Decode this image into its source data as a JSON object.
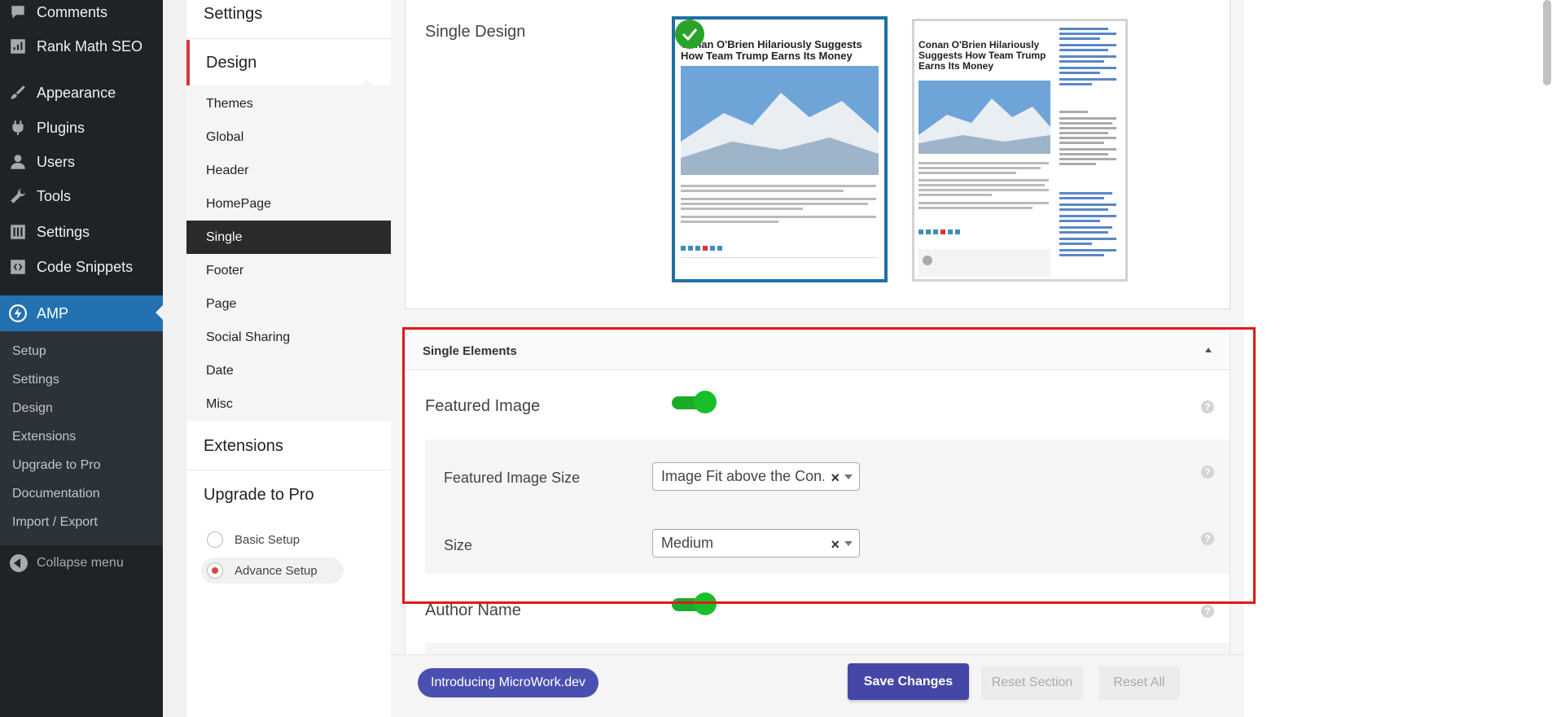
{
  "wp_menu": {
    "items": [
      {
        "label": "Comments",
        "icon": "comment-icon"
      },
      {
        "label": "Rank Math SEO",
        "icon": "rank-math-icon"
      },
      {
        "label": "Appearance",
        "icon": "paintbrush-icon"
      },
      {
        "label": "Plugins",
        "icon": "plug-icon"
      },
      {
        "label": "Users",
        "icon": "user-icon"
      },
      {
        "label": "Tools",
        "icon": "wrench-icon"
      },
      {
        "label": "Settings",
        "icon": "sliders-icon"
      },
      {
        "label": "Code Snippets",
        "icon": "code-icon"
      },
      {
        "label": "AMP",
        "icon": "amp-lightning-icon"
      }
    ],
    "amp_submenu": [
      "Setup",
      "Settings",
      "Design",
      "Extensions",
      "Upgrade to Pro",
      "Documentation",
      "Import / Export"
    ],
    "collapse_label": "Collapse menu"
  },
  "settings_nav": {
    "settings_heading": "Settings",
    "design_heading": "Design",
    "design_items": [
      "Themes",
      "Global",
      "Header",
      "HomePage",
      "Single",
      "Footer",
      "Page",
      "Social Sharing",
      "Date",
      "Misc"
    ],
    "active_item": "Single",
    "extensions_heading": "Extensions",
    "upgrade_heading": "Upgrade to Pro",
    "setup_options": [
      {
        "label": "Basic Setup",
        "selected": false
      },
      {
        "label": "Advance Setup",
        "selected": true
      }
    ]
  },
  "single_design": {
    "label": "Single Design",
    "preview_headline_1": "Conan O'Brien Hilariously Suggests How Team Trump Earns Its Money",
    "preview_headline_2": "Conan O'Brien Hilariously Suggests How Team Trump Earns Its Money",
    "selected_design": 1
  },
  "single_elements": {
    "title": "Single Elements",
    "featured_image": {
      "label": "Featured Image",
      "enabled": true
    },
    "featured_image_size": {
      "label": "Featured Image Size",
      "value": "Image Fit above the Con..."
    },
    "size": {
      "label": "Size",
      "value": "Medium"
    },
    "author_name": {
      "label": "Author Name",
      "enabled": true
    },
    "help_glyph": "?",
    "clear_glyph": "×"
  },
  "footer": {
    "intro_label": "Introducing MicroWork.dev",
    "save_label": "Save Changes",
    "reset_section_label": "Reset Section",
    "reset_all_label": "Reset All"
  },
  "colors": {
    "accent": "#4447a6",
    "toggle_on": "#19bf2a",
    "highlight": "#e01a1a",
    "wp_active": "#2271b1"
  }
}
